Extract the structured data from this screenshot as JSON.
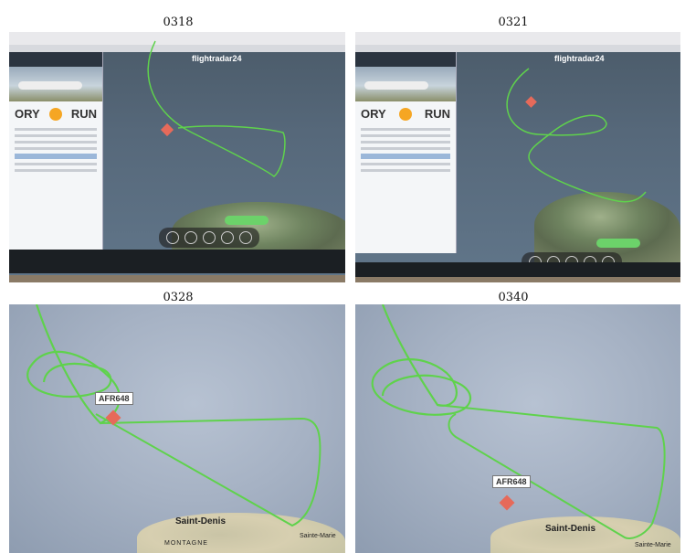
{
  "panels": [
    {
      "label": "0318"
    },
    {
      "label": "0321"
    },
    {
      "label": "0328",
      "flight_tag": "AFR648",
      "city": "Saint-Denis",
      "town": "Sainte-Marie",
      "range": "MONTAGNE"
    },
    {
      "label": "0340",
      "flight_tag": "AFR648",
      "city": "Saint-Denis",
      "town": "Sainte-Marie"
    }
  ],
  "app": {
    "brand": "flightradar24",
    "origin": "ORY",
    "destination": "RUN"
  },
  "colors": {
    "track": "#5fd24c",
    "aircraft": "#e66a5a"
  }
}
